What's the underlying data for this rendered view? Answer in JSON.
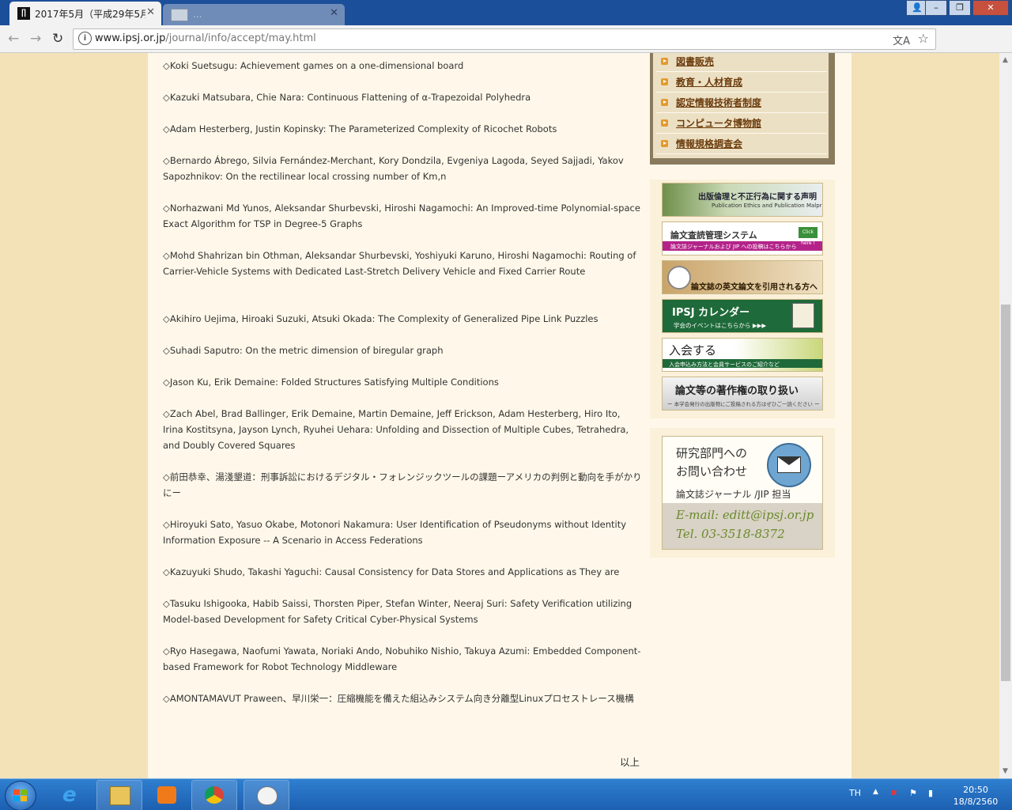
{
  "browser": {
    "active_tab_title": "2017年5月（平成29年5月",
    "active_tab_icon": "ipsj-favicon",
    "inactive_tab_title": "...",
    "url_host": "www.ipsj.or.jp",
    "url_path": "/journal/info/accept/may.html"
  },
  "entries": [
    "◇Koki Suetsugu: Achievement games on a one-dimensional board",
    "◇Kazuki Matsubara, Chie Nara: Continuous Flattening of α-Trapezoidal Polyhedra",
    "◇Adam Hesterberg, Justin Kopinsky: The Parameterized Complexity of Ricochet Robots",
    "◇Bernardo Ábrego, Silvia Fernández-Merchant, Kory Dondzila, Evgeniya Lagoda, Seyed Sajjadi, Yakov Sapozhnikov: On the rectilinear local crossing number of Km,n",
    "◇Norhazwani Md Yunos, Aleksandar Shurbevski, Hiroshi Nagamochi: An Improved-time Polynomial-space Exact Algorithm for TSP in Degree-5 Graphs",
    "◇Mohd Shahrizan bin Othman, Aleksandar Shurbevski, Yoshiyuki Karuno, Hiroshi Nagamochi: Routing of Carrier-Vehicle Systems with Dedicated Last-Stretch Delivery Vehicle and Fixed Carrier Route",
    "◇Akihiro Uejima, Hiroaki Suzuki, Atsuki Okada: The Complexity of Generalized Pipe Link Puzzles",
    "◇Suhadi Saputro: On the metric dimension of biregular graph",
    "◇Jason Ku, Erik Demaine: Folded Structures Satisfying Multiple Conditions",
    "◇Zach Abel, Brad Ballinger, Erik Demaine, Martin Demaine, Jeff Erickson, Adam Hesterberg, Hiro Ito, Irina Kostitsyna, Jayson Lynch, Ryuhei Uehara: Unfolding and Dissection of Multiple Cubes, Tetrahedra, and Doubly Covered Squares",
    "◇前田恭幸、湯淺墾道：刑事訴訟におけるデジタル・フォレンジックツールの課題ーアメリカの判例と動向を手がかりにー",
    "◇Hiroyuki Sato, Yasuo Okabe, Motonori Nakamura: User Identification of Pseudonyms without Identity Information Exposure -- A Scenario in Access Federations",
    "◇Kazuyuki Shudo, Takashi Yaguchi: Causal Consistency for Data Stores and Applications as They are",
    "◇Tasuku Ishigooka, Habib Saissi, Thorsten Piper, Stefan Winter, Neeraj Suri: Safety Verification utilizing Model-based Development for Safety Critical Cyber-Physical Systems",
    "◇Ryo Hasegawa, Naofumi Yawata, Noriaki Ando, Nobuhiko Nishio, Takuya Azumi: Embedded Component-based Framework for Robot Technology Middleware",
    "◇AMONTAMAVUT Praween、早川栄一：圧縮機能を備えた組込みシステム向き分離型Linuxプロセストレース機構"
  ],
  "closing": "以上",
  "sidemenu": [
    "図書販売",
    "教育・人材育成",
    "認定情報技術者制度",
    "コンピュータ博物館",
    "情報規格調査会"
  ],
  "banners": {
    "ethics": {
      "title": "出版倫理と不正行為に関する声明",
      "sub": "Publication Ethics and Publication Malpractice"
    },
    "review": {
      "title": "論文査読管理システム",
      "sub": "論文誌ジャーナルおよび JIP への投稿はこちらから",
      "tag": "Click here !"
    },
    "cite": {
      "title": "論文誌の英文論文を引用される方へ"
    },
    "calendar": {
      "title": "IPSJ カレンダー",
      "sub": "学会のイベントはこちらから ▶▶▶"
    },
    "join": {
      "title": "入会する",
      "sub": "入会申込み方法と会員サービスのご紹介など"
    },
    "copyright": {
      "title": "論文等の著作権の取り扱い",
      "sub": "ー 本学会発行の出版物にご投稿される方はぜひご一読ください ー"
    }
  },
  "contact": {
    "line1": "研究部門への",
    "line2": "お問い合わせ",
    "dept": "論文誌ジャーナル /JIP 担当",
    "email": "E-mail: editt@ipsj.or.jp",
    "tel": "Tel. 03-3518-8372"
  },
  "taskbar": {
    "lang": "TH",
    "time": "20:50",
    "date": "18/8/2560"
  }
}
